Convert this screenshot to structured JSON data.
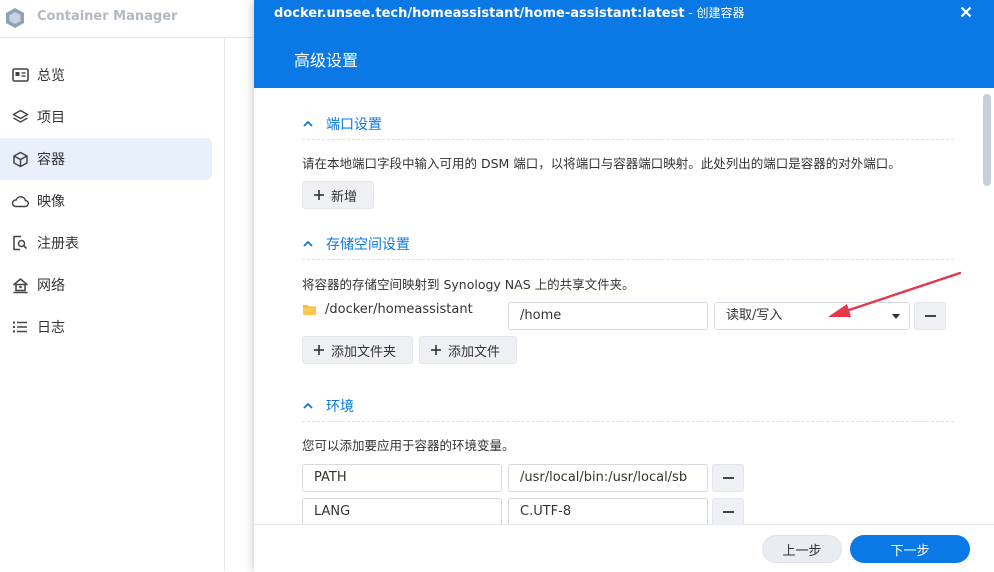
{
  "app": {
    "title": "Container Manager"
  },
  "sidebar": {
    "items": [
      {
        "label": "总览",
        "icon": "overview-icon"
      },
      {
        "label": "项目",
        "icon": "layers-icon"
      },
      {
        "label": "容器",
        "icon": "cube-icon",
        "active": true
      },
      {
        "label": "映像",
        "icon": "cloud-icon"
      },
      {
        "label": "注册表",
        "icon": "registry-search-icon"
      },
      {
        "label": "网络",
        "icon": "network-house-icon"
      },
      {
        "label": "日志",
        "icon": "list-icon"
      }
    ]
  },
  "modal": {
    "image": "docker.unsee.tech/homeassistant/home-assistant:latest",
    "title_suffix": " - 创建容器",
    "step_title": "高级设置",
    "sections": {
      "ports": {
        "title": "端口设置",
        "desc": "请在本地端口字段中输入可用的 DSM 端口，以将端口与容器端口映射。此处列出的端口是容器的对外端口。",
        "add_label": "新增"
      },
      "storage": {
        "title": "存储空间设置",
        "desc": "将容器的存储空间映射到 Synology NAS 上的共享文件夹。",
        "folder": "/docker/homeassistant",
        "mount_path": "/home",
        "permission": "读取/写入",
        "add_folder_label": "添加文件夹",
        "add_file_label": "添加文件"
      },
      "env": {
        "title": "环境",
        "desc": "您可以添加要应用于容器的环境变量。",
        "vars": [
          {
            "key": "PATH",
            "value": "/usr/local/bin:/usr/local/sb"
          },
          {
            "key": "LANG",
            "value": "C.UTF-8"
          }
        ]
      }
    },
    "footer": {
      "prev_label": "上一步",
      "next_label": "下一步"
    }
  },
  "colors": {
    "accent": "#0a79e6",
    "annotation_arrow": "#e8364a"
  }
}
